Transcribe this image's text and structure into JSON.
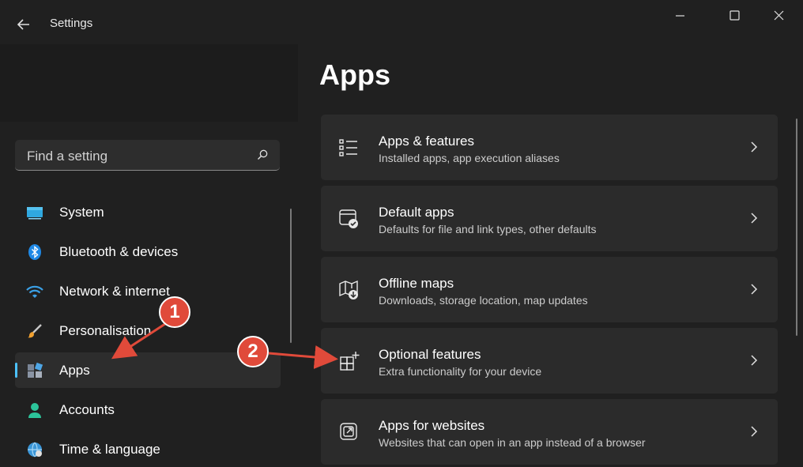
{
  "window": {
    "title": "Settings",
    "controls": [
      "minimize-icon",
      "maximize-icon",
      "close-icon"
    ]
  },
  "search": {
    "placeholder": "Find a setting"
  },
  "sidebar": {
    "items": [
      {
        "label": "System",
        "icon": "system-icon"
      },
      {
        "label": "Bluetooth & devices",
        "icon": "bluetooth-icon"
      },
      {
        "label": "Network & internet",
        "icon": "wifi-icon"
      },
      {
        "label": "Personalisation",
        "icon": "brush-icon"
      },
      {
        "label": "Apps",
        "icon": "apps-icon",
        "selected": true
      },
      {
        "label": "Accounts",
        "icon": "person-icon"
      },
      {
        "label": "Time & language",
        "icon": "globe-icon"
      }
    ]
  },
  "main": {
    "title": "Apps",
    "cards": [
      {
        "title": "Apps & features",
        "subtitle": "Installed apps, app execution aliases",
        "icon": "list-icon"
      },
      {
        "title": "Default apps",
        "subtitle": "Defaults for file and link types, other defaults",
        "icon": "default-apps-icon"
      },
      {
        "title": "Offline maps",
        "subtitle": "Downloads, storage location, map updates",
        "icon": "map-icon"
      },
      {
        "title": "Optional features",
        "subtitle": "Extra functionality for your device",
        "icon": "optional-features-icon"
      },
      {
        "title": "Apps for websites",
        "subtitle": "Websites that can open in an app instead of a browser",
        "icon": "open-external-icon"
      }
    ]
  },
  "annotations": {
    "badges": [
      "1",
      "2"
    ],
    "color": "#e04a3a"
  },
  "colors": {
    "accent": "#4cc2ff",
    "background": "#202020",
    "card": "#2b2b2b"
  }
}
